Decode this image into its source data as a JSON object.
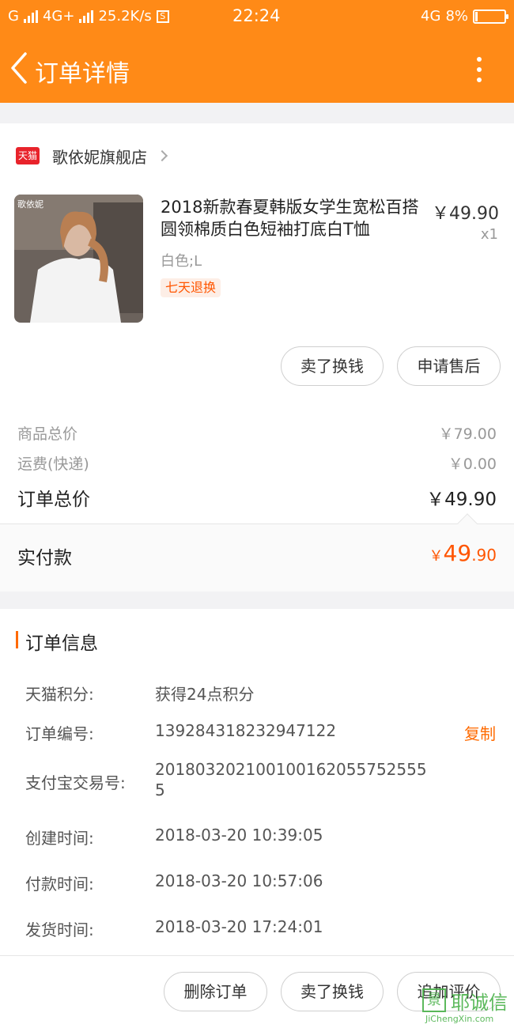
{
  "status_bar": {
    "carrier_left": "G",
    "network": "4G+",
    "speed": "25.2K/s",
    "s_icon": "S",
    "time": "22:24",
    "network_right": "4G",
    "battery_pct": "8%",
    "battery_level": 0.08
  },
  "header": {
    "title": "订单详情",
    "back_icon": "chevron-left-icon",
    "more_icon": "more-vertical-icon"
  },
  "shop": {
    "logo_text": "天猫",
    "name": "歌依妮旗舰店"
  },
  "product": {
    "name": "2018新款春夏韩版女学生宽松百搭圆领棉质白色短袖打底白T恤",
    "price": "￥49.90",
    "qty": "x1",
    "sku": "白色;L",
    "badge": "七天退换",
    "image_watermark": "歌依妮"
  },
  "item_actions": {
    "sell": "卖了换钱",
    "after_sale": "申请售后"
  },
  "summary": {
    "goods_label": "商品总价",
    "goods_value": "￥79.00",
    "shipping_label": "运费(快递)",
    "shipping_value": "￥0.00",
    "total_label": "订单总价",
    "total_value": "￥49.90",
    "paid_label": "实付款",
    "paid_symbol": "￥",
    "paid_int": "49",
    "paid_dec": ".90"
  },
  "order_info": {
    "title": "订单信息",
    "points_label": "天猫积分:",
    "points_value": "获得24点积分",
    "order_no_label": "订单编号:",
    "order_no_value": "139284318232947122",
    "copy": "复制",
    "alipay_label": "支付宝交易号:",
    "alipay_value": "2018032021001001620557525555",
    "created_label": "创建时间:",
    "created_value": "2018-03-20 10:39:05",
    "paid_time_label": "付款时间:",
    "paid_time_value": "2018-03-20 10:57:06",
    "shipped_label": "发货时间:",
    "shipped_value": "2018-03-20 17:24:01"
  },
  "bottom_actions": {
    "delete": "删除订单",
    "sell": "卖了换钱",
    "review": "追加评价"
  },
  "watermark": {
    "text": "耶诚信",
    "site": "JiChengXin.com",
    "logo": "景"
  },
  "colors": {
    "header": "#ff8a17",
    "accent": "#ff5500",
    "tmall": "#e8232b"
  }
}
